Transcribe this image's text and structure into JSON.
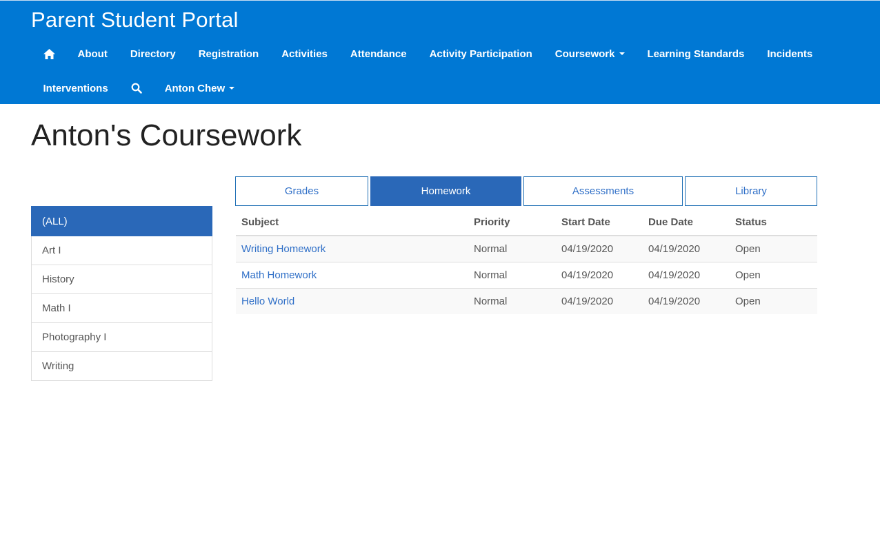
{
  "header": {
    "brand": "Parent Student Portal",
    "nav_row1": [
      {
        "label": "About"
      },
      {
        "label": "Directory"
      },
      {
        "label": "Registration"
      },
      {
        "label": "Activities"
      },
      {
        "label": "Attendance"
      },
      {
        "label": "Activity Participation"
      },
      {
        "label": "Coursework"
      },
      {
        "label": "Learning Standards"
      },
      {
        "label": "Incidents"
      }
    ],
    "nav_row2": {
      "interventions": "Interventions",
      "user": "Anton Chew"
    },
    "icons": {
      "home": "home-icon",
      "search": "search-icon"
    },
    "colors": {
      "bar": "#0078d4",
      "active": "#2a68b8",
      "link": "#2f6fc7"
    }
  },
  "main": {
    "title": "Anton's Coursework",
    "sidebar": [
      "(ALL)",
      "Art I",
      "History",
      "Math I",
      "Photography I",
      "Writing"
    ],
    "sidebar_active": "(ALL)",
    "tabs": [
      "Grades",
      "Homework",
      "Assessments",
      "Library"
    ],
    "active_tab": "Homework",
    "table": {
      "columns": [
        "Subject",
        "Priority",
        "Start Date",
        "Due Date",
        "Status"
      ],
      "rows": [
        [
          "Writing Homework",
          "Normal",
          "04/19/2020",
          "04/19/2020",
          "Open"
        ],
        [
          "Math Homework",
          "Normal",
          "04/19/2020",
          "04/19/2020",
          "Open"
        ],
        [
          "Hello World",
          "Normal",
          "04/19/2020",
          "04/19/2020",
          "Open"
        ]
      ]
    }
  }
}
